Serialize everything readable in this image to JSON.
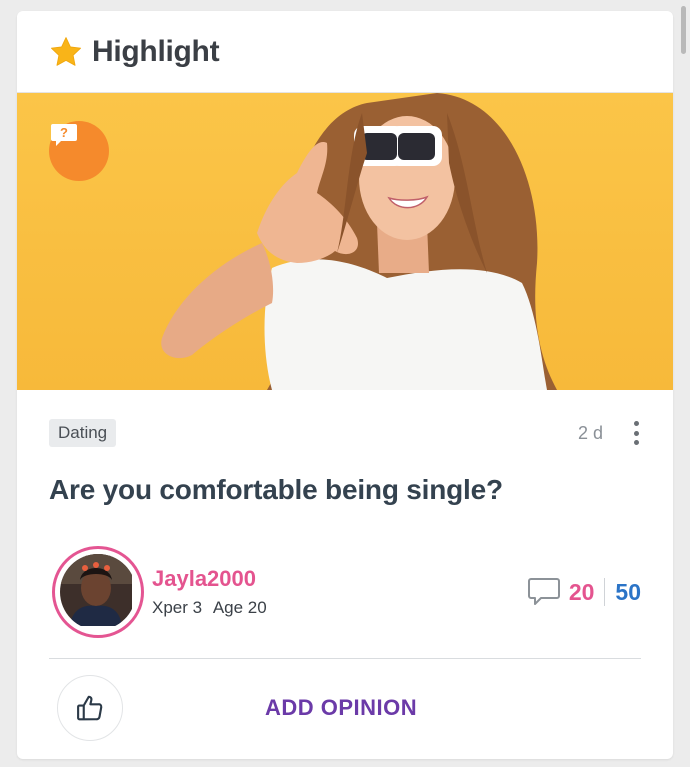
{
  "header": {
    "title": "Highlight",
    "icon": "star-icon"
  },
  "hero": {
    "badge_icon": "question-bubble-icon",
    "badge_text": "?"
  },
  "post": {
    "category": "Dating",
    "age": "2 d",
    "question": "Are you comfortable being single?"
  },
  "author": {
    "username": "Jayla2000",
    "xper": "Xper 3",
    "age": "Age 20"
  },
  "stats": {
    "opinions": "20",
    "votes": "50"
  },
  "actions": {
    "add_opinion": "ADD OPINION"
  },
  "colors": {
    "accent_pink": "#e4548f",
    "accent_blue": "#2b74c7",
    "accent_purple": "#6b3aa8",
    "badge_orange": "#f58a2c",
    "hero_yellow": "#fbc548",
    "star_yellow": "#f9b418"
  }
}
